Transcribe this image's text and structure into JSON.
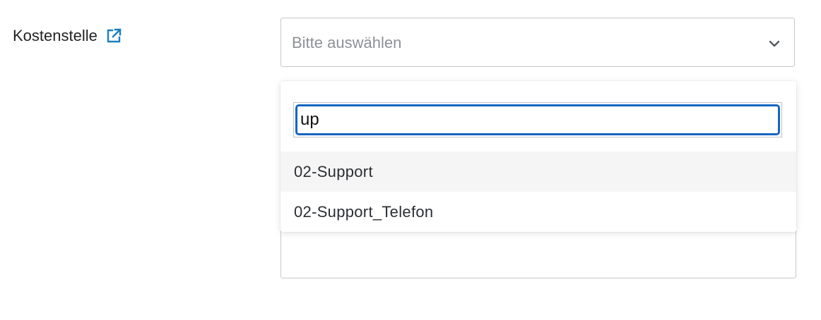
{
  "field": {
    "label": "Kostenstelle",
    "link_icon": "external-link-icon",
    "link_icon_color": "#1a7fc1"
  },
  "select": {
    "placeholder": "Bitte auswählen",
    "chevron_icon": "chevron-down-icon"
  },
  "dropdown": {
    "search_value": "up",
    "focus_color": "#1565c0",
    "options": [
      {
        "label": "02-Support",
        "highlighted": true
      },
      {
        "label": "02-Support_Telefon",
        "highlighted": false
      }
    ]
  }
}
